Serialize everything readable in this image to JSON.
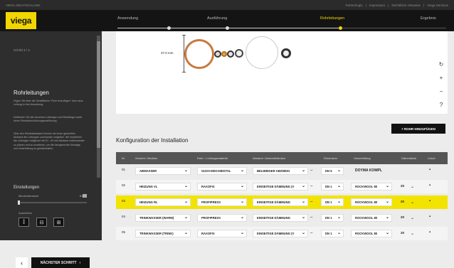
{
  "topbar": {
    "brand": "VIEGA DEUTSCHLAND",
    "links": [
      "Partnerlogin",
      "Impressum",
      "Rechtliche Hinweise",
      "Viega Services"
    ]
  },
  "logo": "viega",
  "steps": [
    {
      "label": "Anwendung",
      "state": "done"
    },
    {
      "label": "Ausführung",
      "state": "done"
    },
    {
      "label": "Rohrleitungen",
      "state": "active"
    },
    {
      "label": "Ergebnis",
      "state": "todo"
    }
  ],
  "sidebar": {
    "step_no": "Schritt 3 / 4",
    "title": "Rohrleitungen",
    "p1": "Fügen Sie über die Schaltfläche \"Rohr hinzufügen\" eine neue Leitung in Ihre Anordnung.",
    "p2": "Definieren Sie die einzelnen Leitungen und Rohrlänge sowie deren Brandschutzlösungsausführung.",
    "p3": "Über den Mindestabstand können sie einen generellen Abstand der Leitungen zueinander vorgeben. Wir empfehlen die Leitungen möglichst mit 20 - 40 mm Abstand untereinander zu planen und zu montieren, um die fachgerechte Montage und Verarbeitung zu gewährleisten.",
    "settings_title": "Einstellungen",
    "min_label": "Mindestabstand",
    "min_value": "0 mm",
    "min_slider_value": 0,
    "align_label": "Ausrichten",
    "back_label": "‹",
    "next_label": "NÄCHSTER SCHRITT",
    "next_icon": "›"
  },
  "canvas": {
    "dimension": "37.0 mm",
    "tools": [
      "↻",
      "+",
      "−",
      "?"
    ]
  },
  "add_row_label": "+ ROHR HINZUFÜGEN",
  "config_title": "Konfiguration der Installation",
  "table": {
    "headers": [
      "Nr",
      "Gewerk / Medium",
      "Rohr- / Leitungsmaterial",
      "Abstand / Abschottsitution",
      "Dimension",
      "Umschüttung",
      "Dämmdicke",
      "Lösch"
    ],
    "rows": [
      {
        "nr": "01",
        "medium": "ABWASSER",
        "material": "GUSS-MISCHINSTAL",
        "shutoff": "BELIEBIGER ABZWEIG",
        "dim": "DN 5",
        "insulation": "DOYMA KOMPL",
        "thickness": "",
        "highlight": false
      },
      {
        "nr": "02",
        "medium": "HEIZUNG VL",
        "material": "RAXOFIX",
        "shutoff": "EINSEITIGE DÄMMUNG (V",
        "dim": "DN 1",
        "insulation": "ROCKWOOL 80",
        "thickness": "20",
        "highlight": false
      },
      {
        "nr": "03",
        "medium": "HEIZUNG RL",
        "material": "PROFIPRESS",
        "shutoff": "EINSEITIGE DÄMMUNG",
        "dim": "DN 1",
        "insulation": "ROCKWOOL 80",
        "thickness": "20",
        "highlight": true
      },
      {
        "nr": "04",
        "medium": "TRINKWASSER (WARM)",
        "material": "PROFIPRESS",
        "shutoff": "EINSEITIGE DÄMMUNG",
        "dim": "DN 1",
        "insulation": "ROCKWOOL 80",
        "thickness": "20",
        "highlight": false
      },
      {
        "nr": "05",
        "medium": "TRINKWASSER (TRINK)",
        "material": "RAXOFIX",
        "shutoff": "EINSEITIGE DÄMMUNG (V",
        "dim": "DN 1",
        "insulation": "ROCKWOOL 80",
        "thickness": "20",
        "highlight": false
      }
    ]
  },
  "colors": {
    "accent": "#f2d600",
    "dark": "#141414",
    "pipe_orange": "#c87a3e"
  }
}
